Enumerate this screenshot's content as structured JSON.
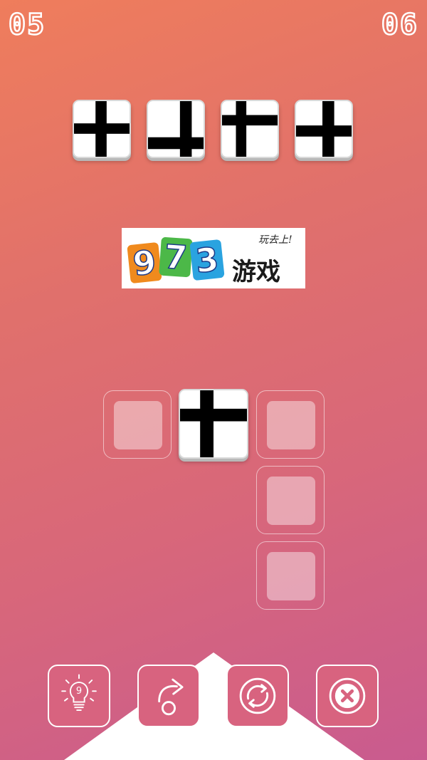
{
  "hud": {
    "level": "05",
    "moves": "06"
  },
  "target_sequence": [
    {
      "shape": "cross"
    },
    {
      "shape": "cross-low-left-short"
    },
    {
      "shape": "cross-high-right-short"
    },
    {
      "shape": "cross-low"
    }
  ],
  "logo": {
    "digits": [
      "9",
      "7",
      "3"
    ],
    "digit_colors": [
      "#f08a1d",
      "#4cb848",
      "#2aa3e0"
    ],
    "tagline": "玩去上!",
    "name": "游戏"
  },
  "board": {
    "placed_tile": {
      "shape": "cross"
    },
    "empty_slots": 4
  },
  "toolbar": {
    "hint": {
      "icon": "lightbulb-icon",
      "count": "9"
    },
    "skip": {
      "icon": "curved-arrow-icon"
    },
    "restart": {
      "icon": "refresh-icon"
    },
    "close": {
      "icon": "close-icon"
    }
  },
  "colors": {
    "bg_top": "#ef7d5c",
    "bg_bottom": "#c95b8f",
    "tile": "#ffffff",
    "glyph": "#000000"
  }
}
